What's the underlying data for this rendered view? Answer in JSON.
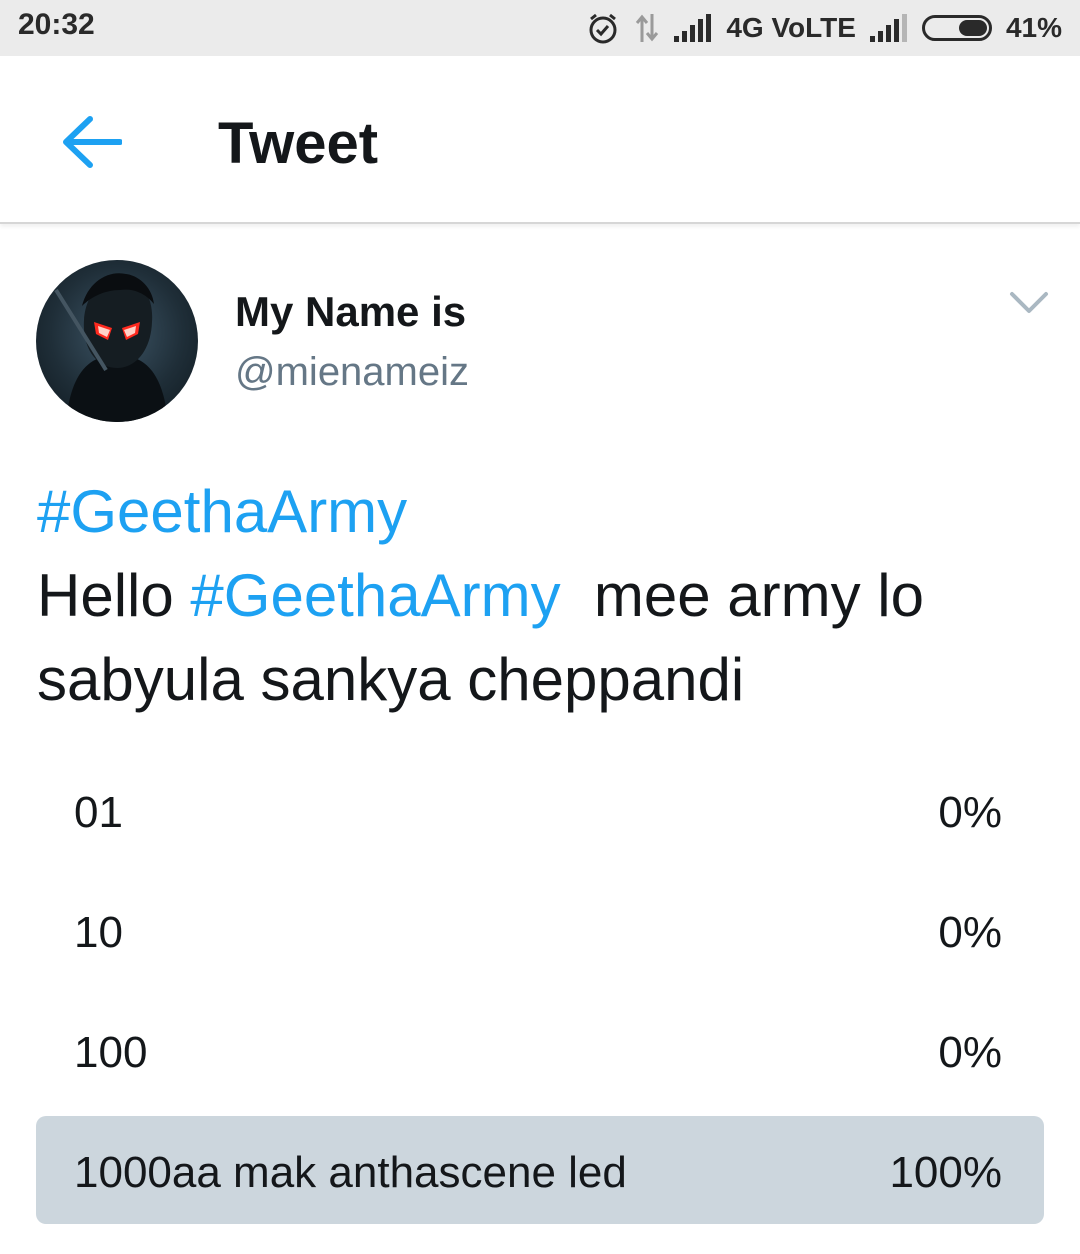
{
  "status_bar": {
    "time": "20:32",
    "network": "4G VoLTE",
    "battery_percent": "41%",
    "icons": [
      "alarm-icon",
      "data-transfer-icon",
      "signal-icon",
      "signal-icon-2",
      "battery-icon"
    ]
  },
  "header": {
    "back_icon": "arrow-left-icon",
    "title": "Tweet",
    "accent_color": "#1da1f2"
  },
  "tweet": {
    "author_name": "My Name is",
    "author_handle": "@mienameiz",
    "menu_icon": "chevron-down-icon",
    "line1_hashtag": "#GeethaArmy",
    "line2_prefix": "Hello ",
    "line2_hashtag": "#GeethaArmy",
    "line2_suffix": "  mee army lo sabyula sankya cheppandi"
  },
  "poll": {
    "options": [
      {
        "label": "01",
        "percent": "0%",
        "value": 0
      },
      {
        "label": "10",
        "percent": "0%",
        "value": 0
      },
      {
        "label": "100",
        "percent": "0%",
        "value": 0
      },
      {
        "label": "1000aa mak anthascene led",
        "percent": "100%",
        "value": 100
      }
    ],
    "winner_color": "#ccd6dd"
  }
}
